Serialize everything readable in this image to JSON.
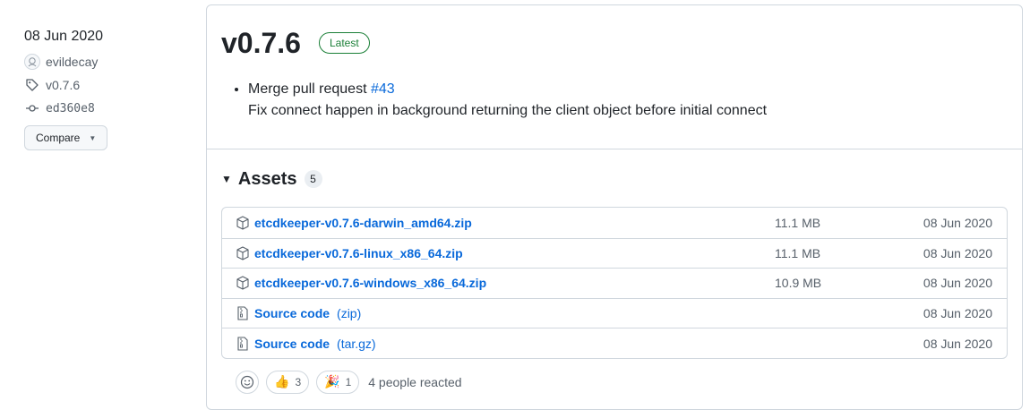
{
  "sidebar": {
    "date": "08 Jun 2020",
    "author": "evildecay",
    "tag": "v0.7.6",
    "commit": "ed360e8",
    "compare_label": "Compare"
  },
  "release": {
    "title": "v0.7.6",
    "badge": "Latest",
    "notes": {
      "line1_prefix": "Merge pull request",
      "line1_link": "#43",
      "line2": "Fix connect happen in background returning the client object before initial connect"
    }
  },
  "assets": {
    "heading": "Assets",
    "count": "5",
    "rows": [
      {
        "name": "etcdkeeper-v0.7.6-darwin_amd64.zip",
        "sub": "",
        "size": "11.1 MB",
        "date": "08 Jun 2020",
        "icon": "package-icon"
      },
      {
        "name": "etcdkeeper-v0.7.6-linux_x86_64.zip",
        "sub": "",
        "size": "11.1 MB",
        "date": "08 Jun 2020",
        "icon": "package-icon"
      },
      {
        "name": "etcdkeeper-v0.7.6-windows_x86_64.zip",
        "sub": "",
        "size": "10.9 MB",
        "date": "08 Jun 2020",
        "icon": "package-icon"
      },
      {
        "name": "Source code",
        "sub": "(zip)",
        "size": "",
        "date": "08 Jun 2020",
        "icon": "file-zip-icon"
      },
      {
        "name": "Source code",
        "sub": "(tar.gz)",
        "size": "",
        "date": "08 Jun 2020",
        "icon": "file-zip-icon"
      }
    ]
  },
  "reactions": {
    "thumbs_up_count": "3",
    "tada_count": "1",
    "summary": "4 people reacted"
  },
  "colors": {
    "accent_link": "#0969da",
    "latest_green": "#1a7f37",
    "border": "#d0d7de",
    "muted_text": "#57606a"
  }
}
